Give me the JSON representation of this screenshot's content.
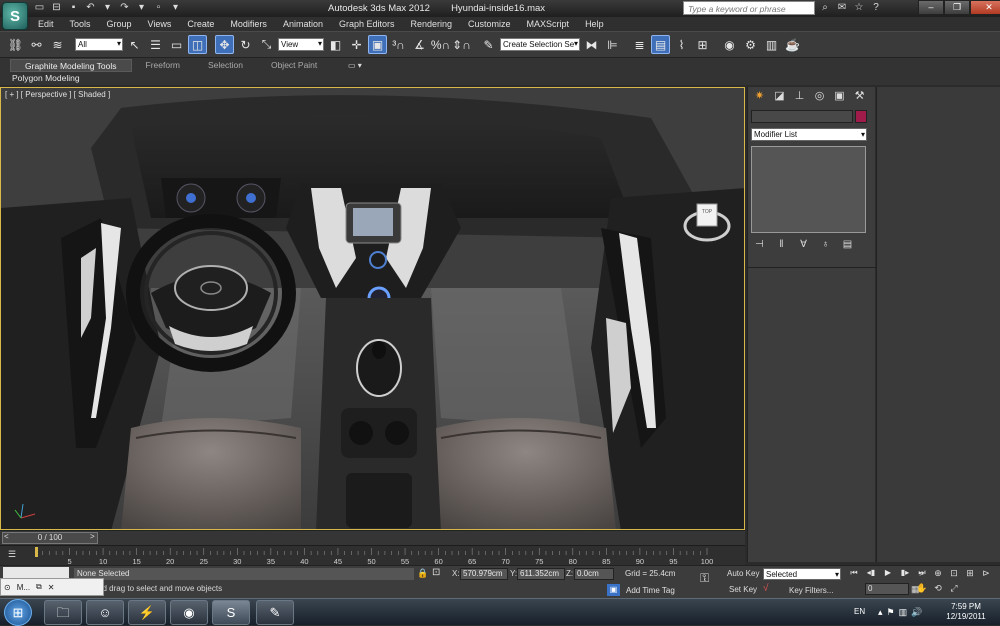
{
  "window": {
    "app_title": "Autodesk 3ds Max  2012",
    "file_name": "Hyundai-inside16.max",
    "search_placeholder": "Type a keyword or phrase",
    "logo_letter": "S"
  },
  "menu": [
    "Edit",
    "Tools",
    "Group",
    "Views",
    "Create",
    "Modifiers",
    "Animation",
    "Graph Editors",
    "Rendering",
    "Customize",
    "MAXScript",
    "Help"
  ],
  "toolbar": {
    "filter_value": "All",
    "refcoord_value": "View",
    "named_selection_value": "Create Selection Se"
  },
  "ribbon": {
    "tabs": [
      "Graphite Modeling Tools",
      "Freeform",
      "Selection",
      "Object Paint"
    ],
    "panel_label": "Polygon Modeling"
  },
  "viewport": {
    "label": "[ + ] [ Perspective ] [ Shaded ]",
    "viewcube_face": "TOP"
  },
  "command_panel": {
    "modifier_list": "Modifier List"
  },
  "timeline": {
    "frame_display": "0 / 100",
    "ticks": [
      "5",
      "10",
      "15",
      "20",
      "25",
      "30",
      "35",
      "40",
      "45",
      "50",
      "55",
      "60",
      "65",
      "70",
      "75",
      "80",
      "85",
      "90",
      "95",
      "100"
    ]
  },
  "status": {
    "mini_label": "M...",
    "selection": "None Selected",
    "prompt": "Click and drag to select and move objects",
    "x_label": "X:",
    "x_value": "570.979cm",
    "y_label": "Y:",
    "y_value": "611.352cm",
    "z_label": "Z:",
    "z_value": "0.0cm",
    "grid": "Grid = 25.4cm",
    "add_time_tag": "Add Time Tag",
    "auto_key": "Auto Key",
    "set_key": "Set Key",
    "key_mode": "Selected",
    "key_filters": "Key Filters...",
    "current_frame": "0"
  },
  "taskbar": {
    "language": "EN",
    "time": "7:59 PM",
    "date": "12/19/2011"
  },
  "colors": {
    "viewport_border": "#d9b84a",
    "active_button": "#3f6fb8",
    "object_color": "#a01a4a"
  }
}
